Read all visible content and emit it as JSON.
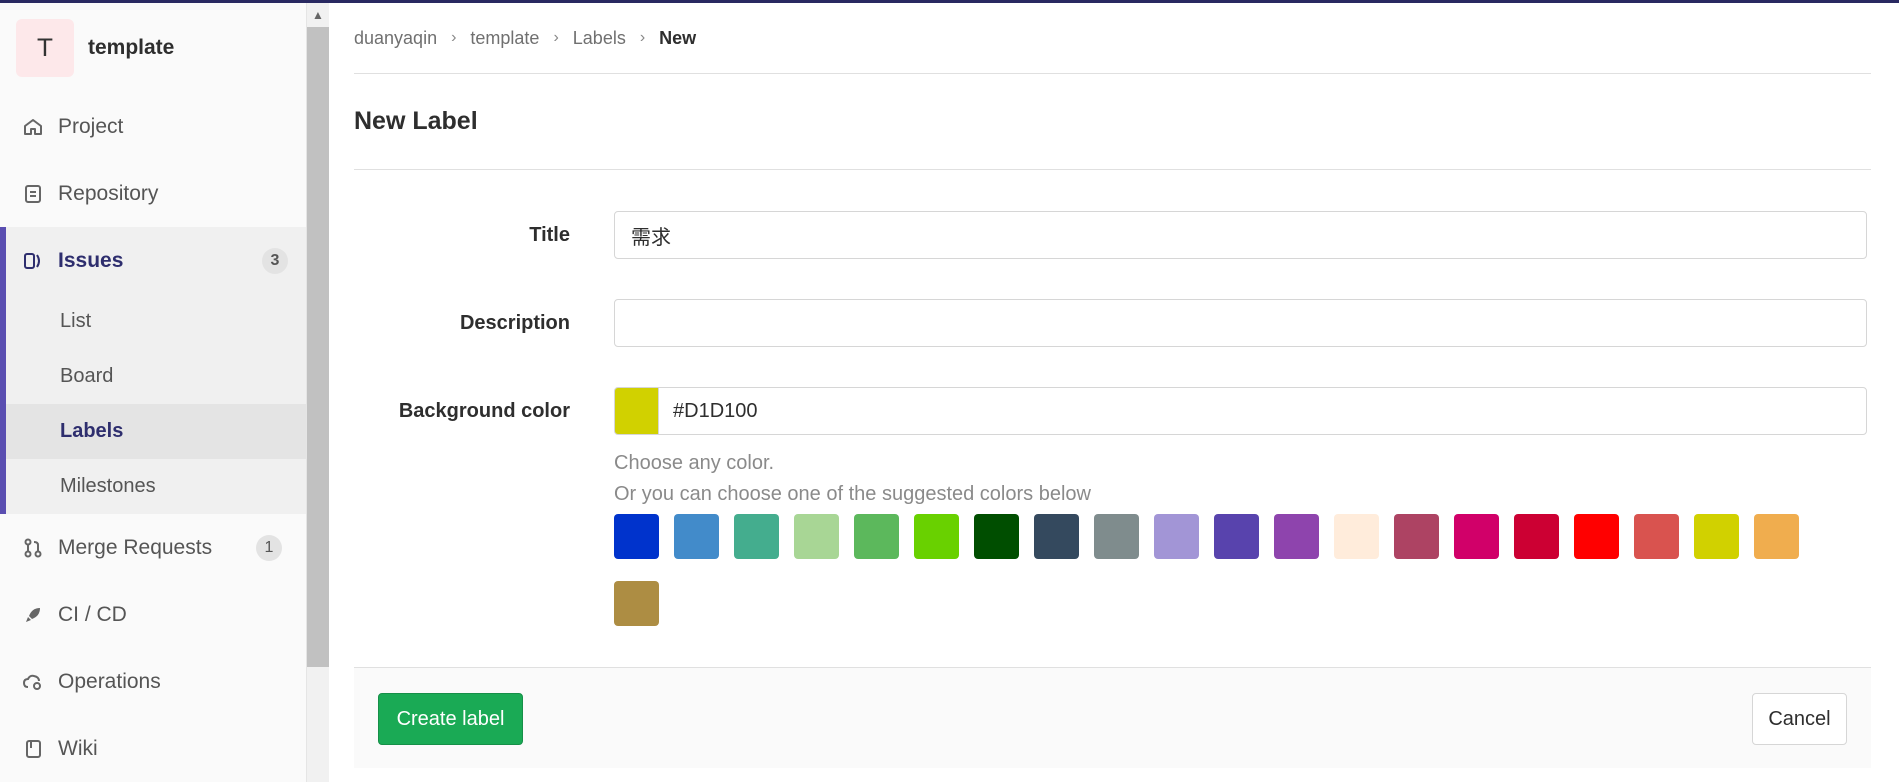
{
  "project": {
    "avatar_letter": "T",
    "name": "template"
  },
  "sidebar": {
    "items": [
      {
        "label": "Project",
        "icon": "home-icon"
      },
      {
        "label": "Repository",
        "icon": "document-icon"
      },
      {
        "label": "Issues",
        "icon": "issues-icon",
        "count": "3",
        "sub": [
          {
            "label": "List"
          },
          {
            "label": "Board"
          },
          {
            "label": "Labels",
            "active": true
          },
          {
            "label": "Milestones"
          }
        ]
      },
      {
        "label": "Merge Requests",
        "icon": "merge-request-icon",
        "count": "1"
      },
      {
        "label": "CI / CD",
        "icon": "rocket-icon"
      },
      {
        "label": "Operations",
        "icon": "cloud-gear-icon"
      },
      {
        "label": "Wiki",
        "icon": "book-icon"
      }
    ]
  },
  "breadcrumb": [
    "duanyaqin",
    "template",
    "Labels",
    "New"
  ],
  "page": {
    "title": "New Label"
  },
  "form": {
    "title_label": "Title",
    "title_value": "需求",
    "description_label": "Description",
    "description_value": "",
    "bg_label": "Background color",
    "bg_value": "#D1D100",
    "bg_color": "#D1D100",
    "help_any": "Choose any color.",
    "help_suggested": "Or you can choose one of the suggested colors below",
    "suggested_colors": [
      "#0033CC",
      "#428BCA",
      "#44AD8E",
      "#A8D695",
      "#5CB85C",
      "#69D100",
      "#004E00",
      "#34495E",
      "#7F8C8D",
      "#A295D6",
      "#5843AD",
      "#8E44AD",
      "#FFECDB",
      "#AD4363",
      "#D10069",
      "#CC0033",
      "#FF0000",
      "#D9534F",
      "#D1D100",
      "#F0AD4E",
      "#AD8D43"
    ]
  },
  "footer": {
    "create_label": "Create label",
    "cancel_label": "Cancel"
  }
}
